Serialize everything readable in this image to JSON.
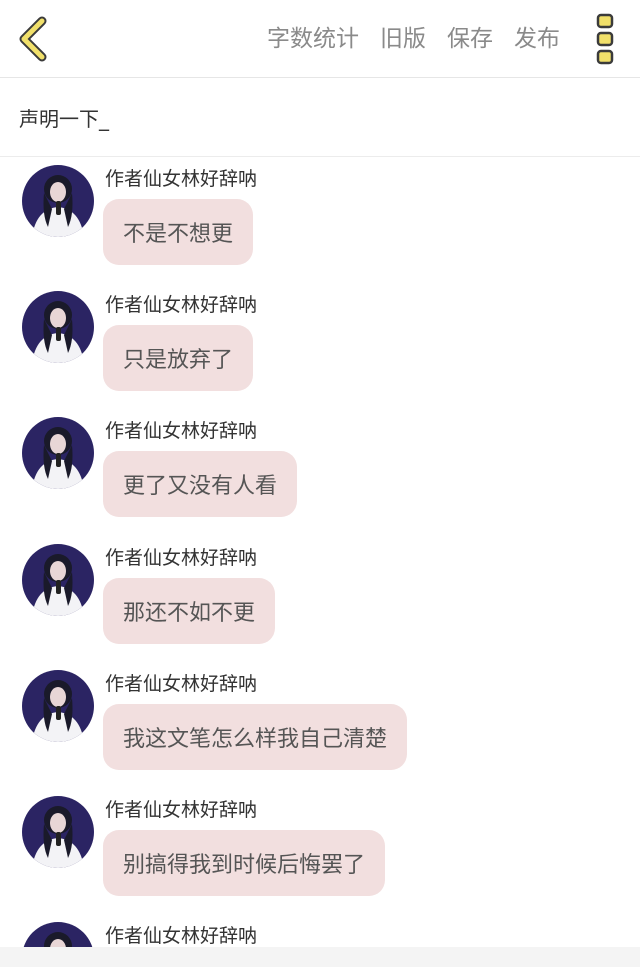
{
  "header": {
    "actions": [
      "字数统计",
      "旧版",
      "保存",
      "发布"
    ],
    "accent": "#f1e06a"
  },
  "title": "声明一下_",
  "messages": [
    {
      "sender": "作者仙女林好辞呐",
      "text": "不是不想更"
    },
    {
      "sender": "作者仙女林好辞呐",
      "text": "只是放弃了"
    },
    {
      "sender": "作者仙女林好辞呐",
      "text": "更了又没有人看"
    },
    {
      "sender": "作者仙女林好辞呐",
      "text": "那还不如不更"
    },
    {
      "sender": "作者仙女林好辞呐",
      "text": "我这文笔怎么样我自己清楚"
    },
    {
      "sender": "作者仙女林好辞呐",
      "text": "别搞得我到时候后悔罢了"
    },
    {
      "sender": "作者仙女林好辞呐",
      "text": ""
    }
  ],
  "bubble_color": "#f2dfdf"
}
